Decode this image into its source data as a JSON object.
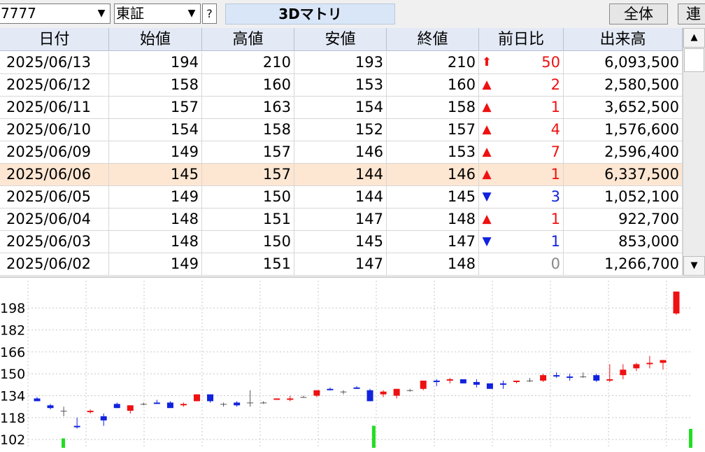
{
  "toolbar": {
    "code": "7777",
    "market": "東証",
    "help_label": "?",
    "stock_name": "3Dマトリ",
    "all_button": "全体",
    "link_button": "連"
  },
  "table": {
    "headers": [
      "日付",
      "始値",
      "高値",
      "安値",
      "終値",
      "前日比",
      "出来高"
    ],
    "selected_row": 5,
    "rows": [
      {
        "date": "2025/06/13",
        "open": "194",
        "high": "210",
        "low": "193",
        "close": "210",
        "dir": "up-limit",
        "change": "50",
        "volume": "6,093,500"
      },
      {
        "date": "2025/06/12",
        "open": "158",
        "high": "160",
        "low": "153",
        "close": "160",
        "dir": "up",
        "change": "2",
        "volume": "2,580,500"
      },
      {
        "date": "2025/06/11",
        "open": "157",
        "high": "163",
        "low": "154",
        "close": "158",
        "dir": "up",
        "change": "1",
        "volume": "3,652,500"
      },
      {
        "date": "2025/06/10",
        "open": "154",
        "high": "158",
        "low": "152",
        "close": "157",
        "dir": "up",
        "change": "4",
        "volume": "1,576,600"
      },
      {
        "date": "2025/06/09",
        "open": "149",
        "high": "157",
        "low": "146",
        "close": "153",
        "dir": "up",
        "change": "7",
        "volume": "2,596,400"
      },
      {
        "date": "2025/06/06",
        "open": "145",
        "high": "157",
        "low": "144",
        "close": "146",
        "dir": "up",
        "change": "1",
        "volume": "6,337,500"
      },
      {
        "date": "2025/06/05",
        "open": "149",
        "high": "150",
        "low": "144",
        "close": "145",
        "dir": "down",
        "change": "3",
        "volume": "1,052,100"
      },
      {
        "date": "2025/06/04",
        "open": "148",
        "high": "151",
        "low": "147",
        "close": "148",
        "dir": "up",
        "change": "1",
        "volume": "922,700"
      },
      {
        "date": "2025/06/03",
        "open": "148",
        "high": "150",
        "low": "145",
        "close": "147",
        "dir": "down",
        "change": "1",
        "volume": "853,000"
      },
      {
        "date": "2025/06/02",
        "open": "149",
        "high": "151",
        "low": "147",
        "close": "148",
        "dir": "none",
        "change": "0",
        "volume": "1,266,700"
      }
    ]
  },
  "colors": {
    "up": "#ee1111",
    "down": "#1122dd",
    "flat": "#888888",
    "selected_row": "#fde6d2",
    "header_bg": "#e3eaf5",
    "volume_bar": "#22dd22"
  },
  "icons": {
    "up": "up-triangle-icon",
    "up_limit": "up-arrow-icon",
    "down": "down-triangle-icon"
  },
  "chart_data": {
    "type": "candlestick",
    "yticks": [
      "198",
      "182",
      "166",
      "150",
      "134",
      "118",
      "102"
    ],
    "ytick_values": [
      198,
      182,
      166,
      150,
      134,
      118,
      102
    ],
    "ylim": [
      96,
      218
    ],
    "grid": true,
    "candles": [
      {
        "o": 132,
        "h": 133,
        "l": 131,
        "c": 130
      },
      {
        "o": 127,
        "h": 128,
        "l": 124,
        "c": 125
      },
      {
        "o": 123,
        "h": 126,
        "l": 119,
        "c": 123
      },
      {
        "o": 112,
        "h": 118,
        "l": 110,
        "c": 111
      },
      {
        "o": 122,
        "h": 124,
        "l": 121,
        "c": 123
      },
      {
        "o": 119,
        "h": 121,
        "l": 112,
        "c": 116
      },
      {
        "o": 128,
        "h": 129,
        "l": 125,
        "c": 125
      },
      {
        "o": 123,
        "h": 126,
        "l": 121,
        "c": 127
      },
      {
        "o": 128,
        "h": 129,
        "l": 127,
        "c": 128
      },
      {
        "o": 129,
        "h": 131,
        "l": 128,
        "c": 128
      },
      {
        "o": 129,
        "h": 130,
        "l": 125,
        "c": 125
      },
      {
        "o": 127,
        "h": 129,
        "l": 126,
        "c": 128
      },
      {
        "o": 130,
        "h": 135,
        "l": 130,
        "c": 135
      },
      {
        "o": 135,
        "h": 135,
        "l": 129,
        "c": 130
      },
      {
        "o": 128,
        "h": 129,
        "l": 126,
        "c": 128
      },
      {
        "o": 129,
        "h": 130,
        "l": 126,
        "c": 127
      },
      {
        "o": 129,
        "h": 138,
        "l": 126,
        "c": 129
      },
      {
        "o": 129,
        "h": 130,
        "l": 128,
        "c": 129
      },
      {
        "o": 131,
        "h": 132,
        "l": 131,
        "c": 132
      },
      {
        "o": 131,
        "h": 134,
        "l": 130,
        "c": 132
      },
      {
        "o": 133,
        "h": 134,
        "l": 133,
        "c": 133
      },
      {
        "o": 134,
        "h": 135,
        "l": 133,
        "c": 138
      },
      {
        "o": 139,
        "h": 140,
        "l": 138,
        "c": 138
      },
      {
        "o": 137,
        "h": 138,
        "l": 135,
        "c": 137
      },
      {
        "o": 140,
        "h": 141,
        "l": 139,
        "c": 139
      },
      {
        "o": 138,
        "h": 139,
        "l": 130,
        "c": 130
      },
      {
        "o": 135,
        "h": 138,
        "l": 133,
        "c": 137
      },
      {
        "o": 134,
        "h": 139,
        "l": 132,
        "c": 139
      },
      {
        "o": 138,
        "h": 139,
        "l": 137,
        "c": 138
      },
      {
        "o": 139,
        "h": 145,
        "l": 138,
        "c": 145
      },
      {
        "o": 145,
        "h": 146,
        "l": 141,
        "c": 144
      },
      {
        "o": 145,
        "h": 147,
        "l": 143,
        "c": 146
      },
      {
        "o": 146,
        "h": 146,
        "l": 143,
        "c": 143
      },
      {
        "o": 144,
        "h": 146,
        "l": 140,
        "c": 142
      },
      {
        "o": 143,
        "h": 143,
        "l": 139,
        "c": 139
      },
      {
        "o": 143,
        "h": 145,
        "l": 139,
        "c": 142
      },
      {
        "o": 144,
        "h": 145,
        "l": 143,
        "c": 145
      },
      {
        "o": 145,
        "h": 147,
        "l": 144,
        "c": 145
      },
      {
        "o": 145,
        "h": 150,
        "l": 144,
        "c": 149
      },
      {
        "o": 149,
        "h": 151,
        "l": 147,
        "c": 148
      },
      {
        "o": 148,
        "h": 150,
        "l": 145,
        "c": 147
      },
      {
        "o": 148,
        "h": 151,
        "l": 147,
        "c": 148
      },
      {
        "o": 149,
        "h": 150,
        "l": 144,
        "c": 145
      },
      {
        "o": 145,
        "h": 157,
        "l": 144,
        "c": 146
      },
      {
        "o": 149,
        "h": 157,
        "l": 146,
        "c": 153
      },
      {
        "o": 154,
        "h": 158,
        "l": 152,
        "c": 157
      },
      {
        "o": 157,
        "h": 163,
        "l": 154,
        "c": 158
      },
      {
        "o": 158,
        "h": 160,
        "l": 153,
        "c": 160
      },
      {
        "o": 194,
        "h": 210,
        "l": 193,
        "c": 210
      }
    ],
    "volume": [
      0.3,
      0,
      0,
      0,
      0,
      0,
      0,
      0,
      0,
      0,
      0,
      0,
      0,
      0,
      0,
      0,
      0,
      0,
      0,
      0,
      0,
      0,
      0,
      0,
      0,
      0,
      0,
      0,
      0,
      0,
      0,
      0,
      0,
      0,
      0,
      0,
      0,
      0,
      0,
      0,
      0,
      0,
      0,
      0,
      0,
      0,
      0,
      0,
      0.7,
      0,
      0,
      0,
      0,
      0,
      0,
      0,
      0,
      0,
      0,
      0,
      0,
      0,
      0,
      0,
      0,
      0,
      0,
      0,
      0,
      0,
      0,
      0,
      0,
      0,
      0,
      0,
      0,
      0,
      0,
      0,
      0,
      0,
      0,
      0,
      0,
      0,
      0,
      0,
      0,
      0,
      0,
      0,
      0,
      0,
      0,
      0,
      0,
      0.6
    ]
  }
}
